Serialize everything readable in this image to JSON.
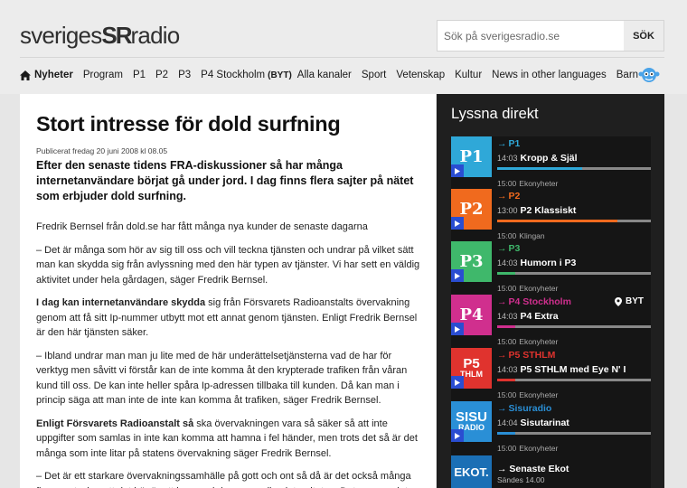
{
  "logo": {
    "part1": "sveriges",
    "part2": "radio"
  },
  "search": {
    "placeholder": "Sök på sverigesradio.se",
    "button": "SÖK"
  },
  "nav": {
    "home": "Nyheter",
    "items": [
      "Program",
      "P1",
      "P2",
      "P3"
    ],
    "p4": "P4 Stockholm",
    "p4_tag": "(BYT)",
    "items2": [
      "Alla kanaler",
      "Sport",
      "Vetenskap",
      "Kultur",
      "News in other languages"
    ],
    "barn": "Barn"
  },
  "article": {
    "title": "Stort intresse för dold surfning",
    "published": "Publicerat fredag 20 juni 2008 kl 08.05",
    "lead": "Efter den senaste tidens FRA-diskussioner så har många internetanvändare börjat gå under jord. I dag finns flera sajter på nätet som erbjuder dold surfning.",
    "p1": "Fredrik Bernsel från dold.se har fått många nya kunder de senaste dagarna",
    "p2": "– Det är många som hör av sig till oss och vill teckna tjänsten och undrar på vilket sätt man kan skydda sig från avlyssning med den här typen av tjänster. Vi har sett en väldig aktivitet under hela gårdagen, säger Fredrik Bernsel.",
    "p3_bold": "I dag kan internetanvändare skydda",
    "p3_rest": " sig från Försvarets Radioanstalts övervakning genom att få sitt Ip-nummer utbytt mot ett annat genom tjänsten. Enligt Fredrik Bernsel är den här tjänsten säker.",
    "p4": "– Ibland undrar man man ju lite med de här underättelsetjänsterna vad de har för verktyg men såvitt vi förstår kan de inte komma åt den krypterade trafiken från våran kund till oss. De kan inte heller spåra Ip-adressen tillbaka till kunden. Då kan man i princip säga att man inte de inte kan komma åt trafiken, säger Fredrik Bernsel.",
    "p5_bold": "Enligt Försvarets Radioanstalt så",
    "p5_rest": " ska övervakningen vara så säker så att inte uppgifter som samlas in inte kan komma att hamna i fel händer, men trots det så är det många som inte litar på statens övervakning säger Fredrik Bernsel.",
    "p6": "– Det är ett starkare övervakningssamhälle på gott och ont så då är det också många fler som tycker att det här är ett ingrepp i den personliga integriteten. Det ser man inte"
  },
  "live": {
    "title": "Lyssna direkt",
    "arrow": "→",
    "channels": [
      {
        "logo": "P1",
        "name": "P1",
        "time": "14:03",
        "program": "Kropp & Själ",
        "next_time": "15:00",
        "next": "Ekonyheter",
        "color": "#2fa8d8",
        "progress": 0.55
      },
      {
        "logo": "P2",
        "name": "P2",
        "time": "13:00",
        "program": "P2 Klassiskt",
        "next_time": "15:00",
        "next": "Klingan",
        "color": "#f06a1e",
        "progress": 0.78
      },
      {
        "logo": "P3",
        "name": "P3",
        "time": "14:03",
        "program": "Humorn i P3",
        "next_time": "15:00",
        "next": "Ekonyheter",
        "color": "#3fb86b",
        "progress": 0.12
      },
      {
        "logo": "P4",
        "name": "P4 Stockholm",
        "time": "14:03",
        "program": "P4 Extra",
        "next_time": "15:00",
        "next": "Ekonyheter",
        "color": "#d02f8e",
        "progress": 0.12,
        "tag": "BYT"
      },
      {
        "logo": "P5",
        "logo_sub": "THLM",
        "name": "P5 STHLM",
        "time": "14:03",
        "program": "P5 STHLM med Eye N' I",
        "next_time": "15:00",
        "next": "Ekonyheter",
        "color": "#e0332e",
        "progress": 0.12
      },
      {
        "logo": "SISU",
        "logo_sub": "RADIO",
        "name": "Sisuradio",
        "time": "14:04",
        "program": "Sisutarinat",
        "next_time": "15:00",
        "next": "Ekonyheter",
        "color": "#2a8fd6",
        "progress": 0.12
      }
    ],
    "ekot": {
      "logo": "EKOT.",
      "title": "Senaste Ekot",
      "sub": "Sändes 14.00"
    }
  }
}
